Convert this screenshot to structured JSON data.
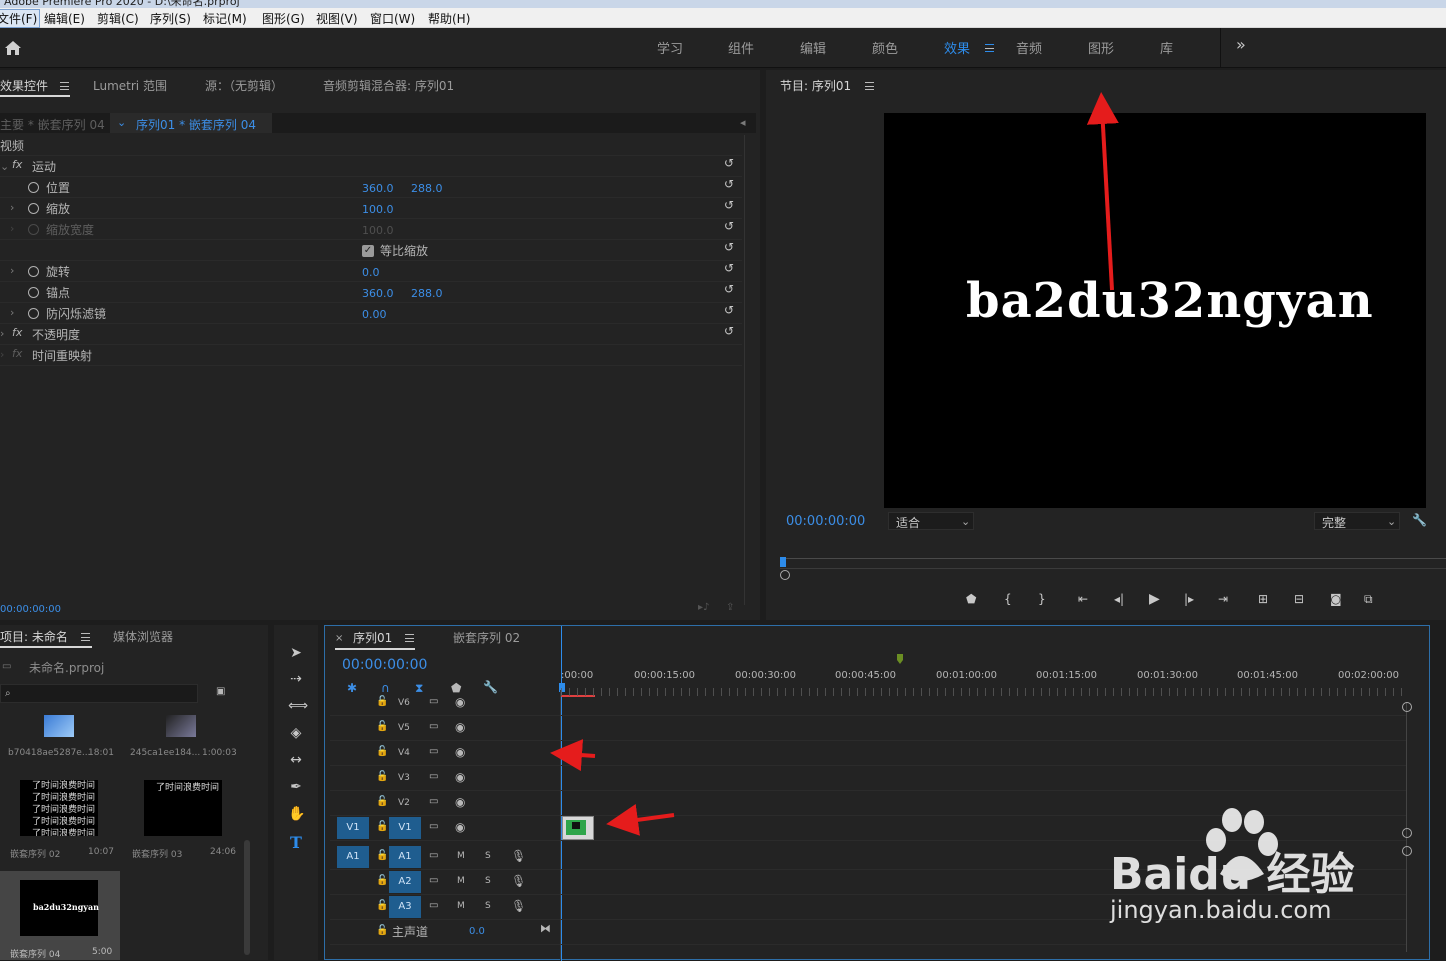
{
  "window": {
    "title": "Adobe Premiere Pro 2020 - D:\\未命名.prproj"
  },
  "menu": [
    "文件(F)",
    "编辑(E)",
    "剪辑(C)",
    "序列(S)",
    "标记(M)",
    "图形(G)",
    "视图(V)",
    "窗口(W)",
    "帮助(H)"
  ],
  "workspaces": {
    "items": [
      "学习",
      "组件",
      "编辑",
      "颜色",
      "效果",
      "音频",
      "图形",
      "库"
    ],
    "active": "效果",
    "more": "»"
  },
  "effect_controls": {
    "tabs": [
      "效果控件",
      "Lumetri 范围",
      "源：（无剪辑）",
      "音频剪辑混合器: 序列01"
    ],
    "master": "主要 * 嵌套序列 04",
    "clip": "序列01 * 嵌套序列 04",
    "section_video": "视频",
    "motion": "运动",
    "position": {
      "label": "位置",
      "x": "360.0",
      "y": "288.0"
    },
    "scale": {
      "label": "缩放",
      "value": "100.0"
    },
    "scale_width": {
      "label": "缩放宽度",
      "value": "100.0"
    },
    "uniform_scale": "等比缩放",
    "rotation": {
      "label": "旋转",
      "value": "0.0"
    },
    "anchor": {
      "label": "锚点",
      "x": "360.0",
      "y": "288.0"
    },
    "anti_flicker": {
      "label": "防闪烁滤镜",
      "value": "0.00"
    },
    "opacity": "不透明度",
    "time_remap": "时间重映射",
    "timecode": "00:00:00:00"
  },
  "program_monitor": {
    "title": "节目: 序列01",
    "frame_text": "ba2du32ngyan",
    "timecode": "00:00:00:00",
    "fit": "适合",
    "quality": "完整"
  },
  "project": {
    "tabs": [
      "项目: 未命名",
      "媒体浏览器"
    ],
    "file": "未命名.prproj",
    "items": [
      {
        "name": "b70418ae5287e...",
        "dur": "18:01"
      },
      {
        "name": "245ca1ee184...",
        "dur": "1:00:03"
      },
      {
        "name": "嵌套序列 02",
        "dur": "10:07",
        "text": "了时间浪费时间"
      },
      {
        "name": "嵌套序列 03",
        "dur": "24:06",
        "text": "了时间浪费时间"
      },
      {
        "name": "嵌套序列 04",
        "dur": "5:00",
        "text": "ba2du32ngyan"
      }
    ]
  },
  "timeline": {
    "tabs": [
      "序列01",
      "嵌套序列 02"
    ],
    "timecode": "00:00:00:00",
    "ruler": [
      ":00:00",
      "00:00:15:00",
      "00:00:30:00",
      "00:00:45:00",
      "00:01:00:00",
      "00:01:15:00",
      "00:01:30:00",
      "00:01:45:00",
      "00:02:00:00"
    ],
    "video_tracks": [
      "V6",
      "V5",
      "V4",
      "V3",
      "V2",
      "V1"
    ],
    "audio_tracks": [
      "A1",
      "A2",
      "A3"
    ],
    "source_v": "V1",
    "source_a": "A1",
    "master": {
      "label": "主声道",
      "value": "0.0"
    },
    "m": "M",
    "s": "S"
  },
  "watermark": {
    "brand": "Baidu 经验",
    "url": "jingyan.baidu.com"
  },
  "colors": {
    "accent": "#2d8ceb",
    "annotation": "#e51c1c"
  }
}
